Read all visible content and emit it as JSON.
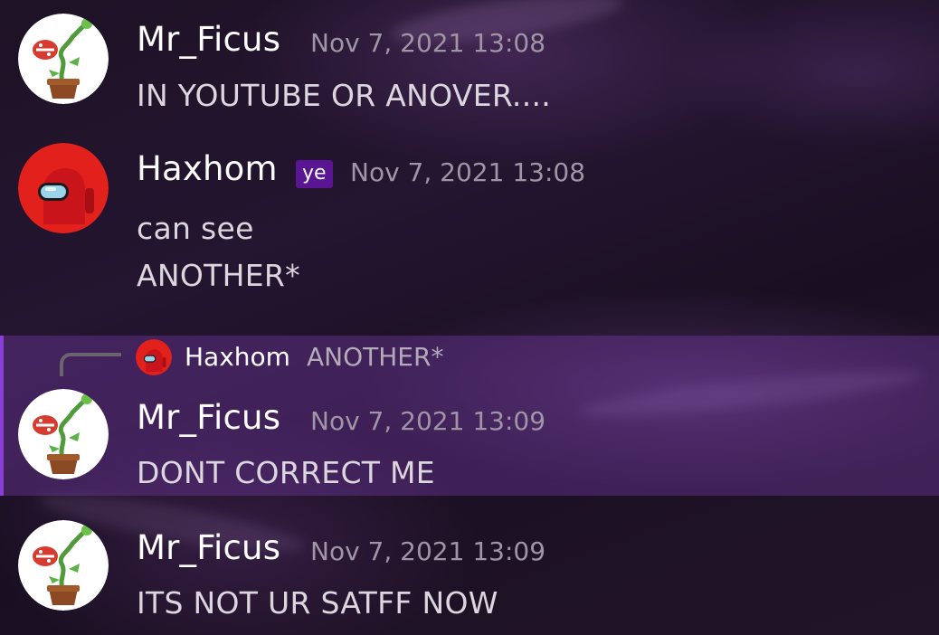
{
  "colors": {
    "username": "#ffffff",
    "timestamp": "#9f95a5",
    "message_text": "#dcd6de",
    "role_tag_bg": "#5a1592",
    "highlight_bg": "#6b3596",
    "highlight_border": "#8a3ed6"
  },
  "messages": [
    {
      "author": "Mr_Ficus",
      "avatar_icon": "piranha-plant-avatar",
      "timestamp": "Nov 7, 2021 13:08",
      "lines": [
        "IN YOUTUBE OR ANOVER...."
      ]
    },
    {
      "author": "Haxhom",
      "avatar_icon": "red-crewmate-avatar",
      "role_tag": "ye",
      "timestamp": "Nov 7, 2021 13:08",
      "lines": [
        "can see",
        "ANOTHER*"
      ]
    },
    {
      "author": "Mr_Ficus",
      "avatar_icon": "piranha-plant-avatar",
      "timestamp": "Nov 7, 2021 13:09",
      "highlighted": true,
      "reply_to": {
        "author": "Haxhom",
        "avatar_icon": "red-crewmate-avatar",
        "text": "ANOTHER*"
      },
      "lines": [
        "DONT CORRECT ME"
      ]
    },
    {
      "author": "Mr_Ficus",
      "avatar_icon": "piranha-plant-avatar",
      "timestamp": "Nov 7, 2021 13:09",
      "lines": [
        "ITS NOT UR SATFF NOW"
      ]
    }
  ]
}
